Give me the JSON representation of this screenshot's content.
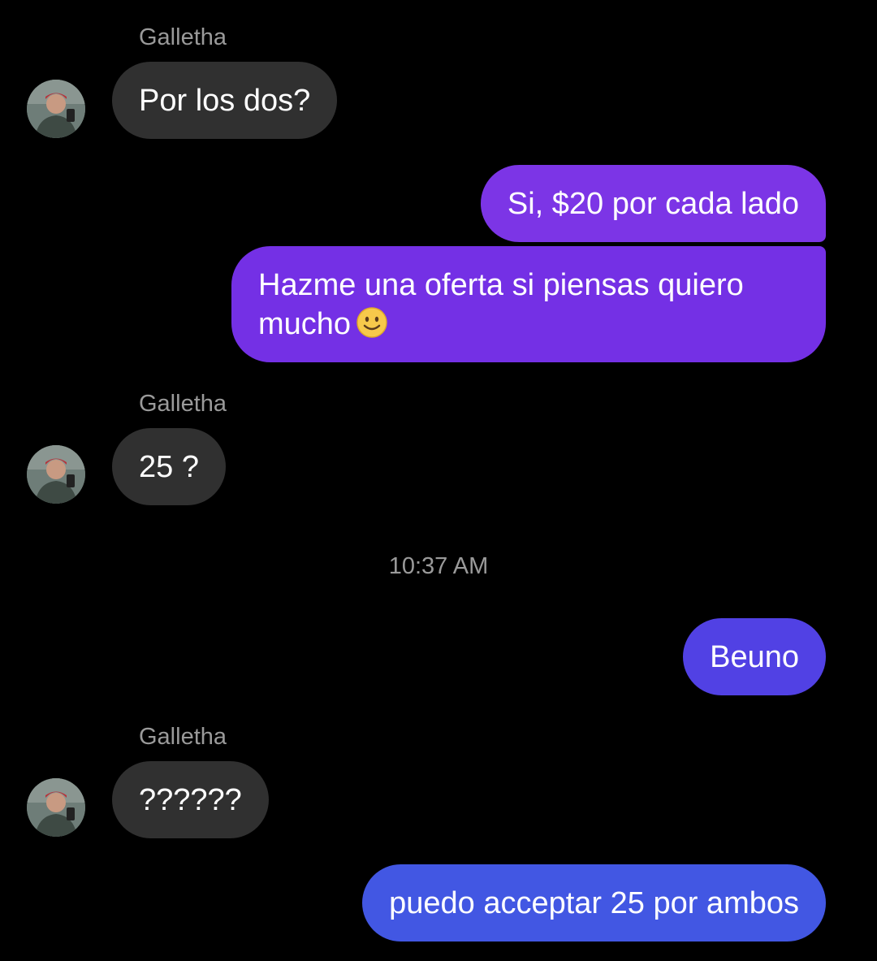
{
  "conversation": {
    "messages": [
      {
        "sender": "Galletha",
        "text": "Por los dos?"
      },
      {
        "text": "Si, $20 por cada lado"
      },
      {
        "text": "Hazme una oferta si piensas quiero mucho",
        "emoji": "slightly-smiling-face"
      },
      {
        "sender": "Galletha",
        "text": "25 ?"
      },
      {
        "timestamp": "10:37 AM"
      },
      {
        "text": "Beuno"
      },
      {
        "sender": "Galletha",
        "text": "??????"
      },
      {
        "text": "puedo acceptar 25 por ambos"
      }
    ]
  },
  "colors": {
    "background": "#000000",
    "incoming_bubble": "#303030",
    "outgoing_gradient": [
      "#7c35e6",
      "#7430e5",
      "#5141e4",
      "#4257e3"
    ],
    "meta_text": "#9a9a9a"
  }
}
